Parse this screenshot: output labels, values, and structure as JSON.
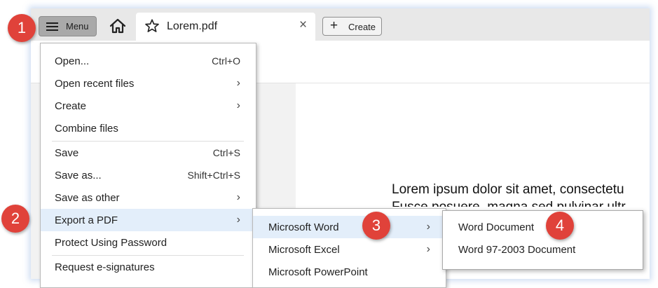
{
  "tabbar": {
    "menu_label": "Menu",
    "doc_tab_name": "Lorem.pdf",
    "close_glyph": "×",
    "create_label": "Create",
    "create_glyph": "+"
  },
  "document": {
    "line1": "Lorem ipsum dolor sit amet, consectetu",
    "line2": "Fusce posuere, magna sed pulvinar ultr",
    "line3": "."
  },
  "menu": {
    "items": [
      {
        "label": "Open...",
        "shortcut": "Ctrl+O"
      },
      {
        "label": "Open recent files",
        "submenu": "›"
      },
      {
        "label": "Create",
        "submenu": "›"
      },
      {
        "label": "Combine files"
      },
      {
        "label": "Save",
        "shortcut": "Ctrl+S"
      },
      {
        "label": "Save as...",
        "shortcut": "Shift+Ctrl+S"
      },
      {
        "label": "Save as other",
        "submenu": "›"
      },
      {
        "label": "Export a PDF",
        "submenu": "›"
      },
      {
        "label": "Protect Using Password"
      },
      {
        "label": "Request e-signatures"
      }
    ]
  },
  "export_submenu": {
    "items": [
      {
        "label": "Microsoft Word",
        "submenu": "›"
      },
      {
        "label": "Microsoft Excel",
        "submenu": "›"
      },
      {
        "label": "Microsoft PowerPoint"
      }
    ]
  },
  "word_submenu": {
    "items": [
      {
        "label": "Word Document"
      },
      {
        "label": "Word 97-2003 Document"
      }
    ]
  },
  "badges": [
    "1",
    "2",
    "3",
    "4"
  ],
  "colors": {
    "badge": "#e0423a",
    "active_row": "#e3eefa",
    "menu_button": "#a9a9a9"
  },
  "icons": [
    "hamburger-icon",
    "home-icon",
    "star-icon",
    "close-icon",
    "plus-icon",
    "chevron-right-icon"
  ]
}
